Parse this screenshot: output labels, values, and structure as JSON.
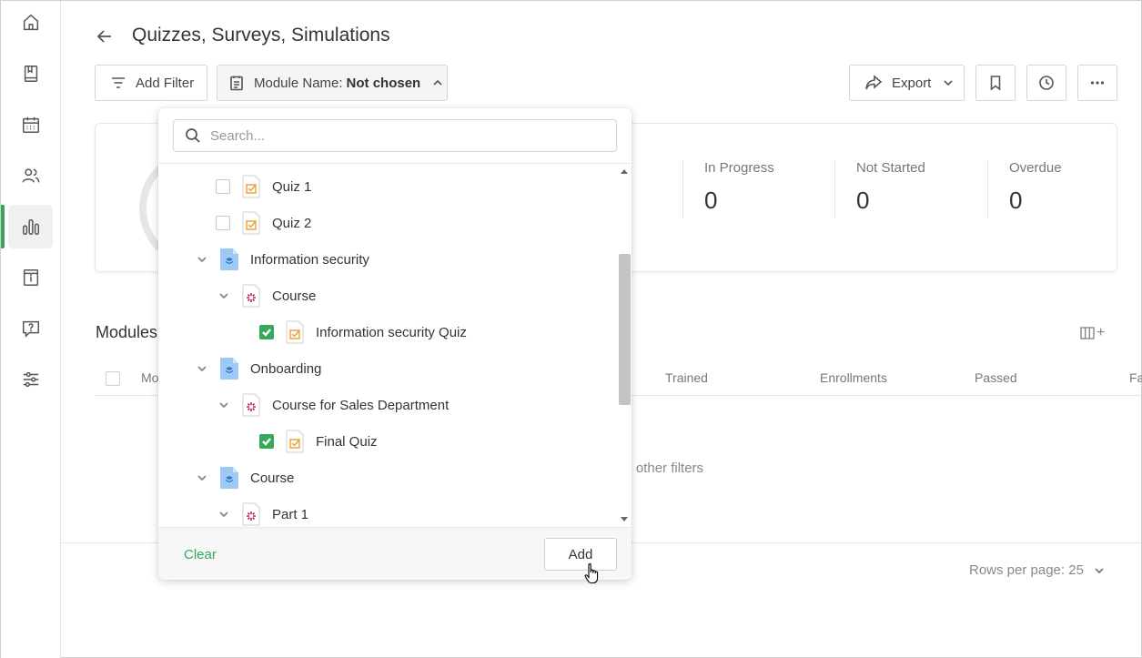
{
  "page": {
    "title": "Quizzes, Surveys, Simulations"
  },
  "sidebar": {
    "items": [
      {
        "icon": "home-icon"
      },
      {
        "icon": "book-icon"
      },
      {
        "icon": "calendar-icon"
      },
      {
        "icon": "users-icon"
      },
      {
        "icon": "bar-chart-icon",
        "active": true
      },
      {
        "icon": "info-card-icon"
      },
      {
        "icon": "question-icon"
      },
      {
        "icon": "sliders-icon"
      }
    ]
  },
  "toolbar": {
    "add_filter_label": "Add Filter",
    "module_filter_label": "Module Name:",
    "module_filter_value": "Not chosen",
    "export_label": "Export"
  },
  "stats": {
    "in_progress_label": "In Progress",
    "in_progress_value": "0",
    "not_started_label": "Not Started",
    "not_started_value": "0",
    "overdue_label": "Overdue",
    "overdue_value": "0"
  },
  "modules": {
    "title": "Modules",
    "columns": [
      "Mo",
      "Trained",
      "Enrollments",
      "Passed",
      "Fa"
    ],
    "empty_partial": "ge other filters"
  },
  "pagination": {
    "rows_per_page_label": "Rows per page: 25"
  },
  "dropdown": {
    "search_placeholder": "Search...",
    "tree": [
      {
        "label": "Quiz 1",
        "type": "quiz",
        "checkbox": true,
        "checked": false
      },
      {
        "label": "Quiz 2",
        "type": "quiz",
        "checkbox": true,
        "checked": false
      },
      {
        "label": "Information security",
        "type": "program",
        "expanded": true
      },
      {
        "label": "Course",
        "type": "course",
        "expanded": true
      },
      {
        "label": "Information security Quiz",
        "type": "quiz",
        "checkbox": true,
        "checked": true
      },
      {
        "label": "Onboarding",
        "type": "program",
        "expanded": true
      },
      {
        "label": "Course for Sales Department",
        "type": "course",
        "expanded": true
      },
      {
        "label": "Final Quiz",
        "type": "quiz",
        "checkbox": true,
        "checked": true
      },
      {
        "label": "Course",
        "type": "program",
        "expanded": true
      },
      {
        "label": "Part 1",
        "type": "course",
        "expanded": true
      }
    ],
    "clear_label": "Clear",
    "add_label": "Add"
  },
  "colors": {
    "accent_green": "#36a85a",
    "quiz_icon": "#e8a030",
    "course_icon": "#c2185b",
    "program_icon": "#90c4f0"
  }
}
